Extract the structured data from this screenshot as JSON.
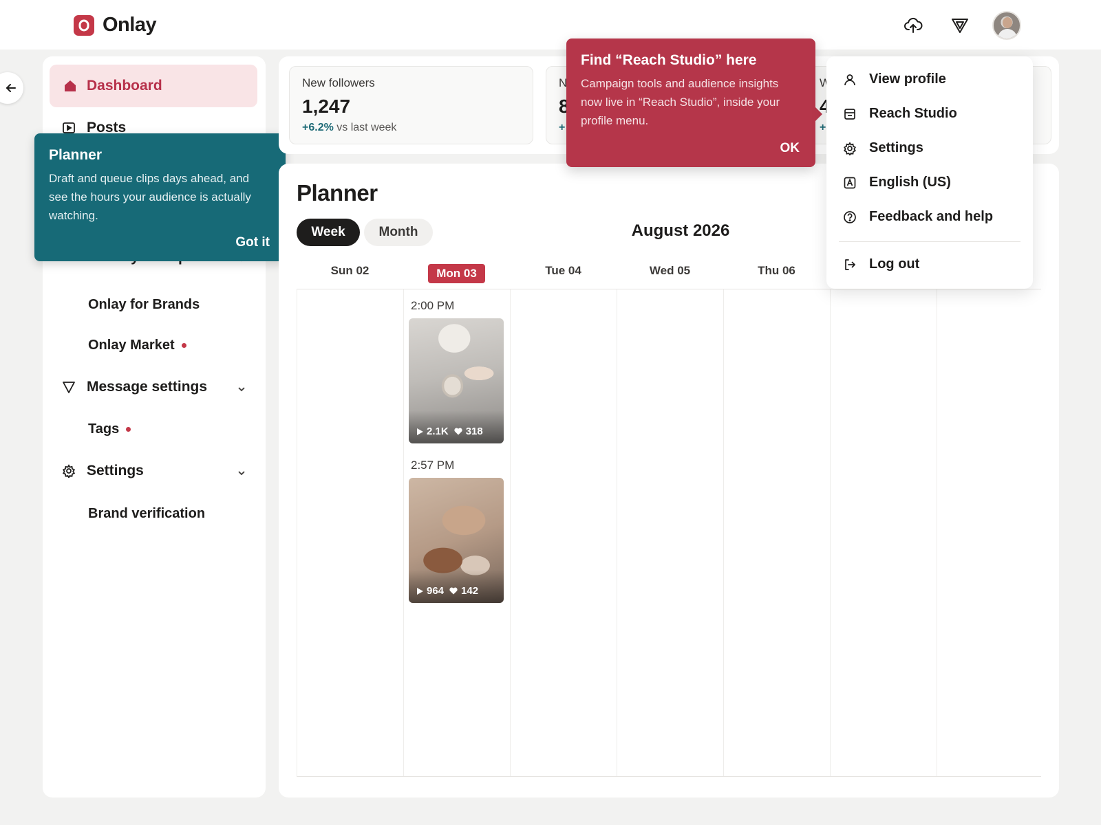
{
  "header": {
    "brand": "Onlay",
    "colors": {
      "brand": "#c43848",
      "teal": "#176a77"
    },
    "icons": [
      "upload-cloud-icon",
      "filter-icon",
      "avatar"
    ]
  },
  "sidebar": {
    "items": [
      {
        "label": "Dashboard",
        "icon": "home-icon",
        "active": true
      },
      {
        "label": "Posts",
        "icon": "play-square-icon"
      },
      {
        "label": "Activity & help",
        "icon": "grid-icon",
        "expandable": true
      },
      {
        "label": "Onlay for Brands",
        "sub": true
      },
      {
        "label": "Onlay Market",
        "sub": true,
        "dot": true
      },
      {
        "label": "Message settings",
        "icon": "filter-icon",
        "expandable": true
      },
      {
        "label": "Tags",
        "sub": true,
        "dot": true
      },
      {
        "label": "Settings",
        "icon": "gear-icon",
        "expandable": true
      },
      {
        "label": "Brand verification",
        "sub": true
      }
    ]
  },
  "planner_tip": {
    "title": "Planner",
    "body": "Draft and queue clips days ahead, and see the hours your audience is actually watching.",
    "action": "Got it"
  },
  "stats": {
    "card1": {
      "label": "New followers",
      "value": "1,247",
      "delta": "+6.2%",
      "delta_suffix": "vs last week"
    },
    "card2": {
      "label": "N",
      "value": "8",
      "delta": "+"
    },
    "card3": {
      "label": "W",
      "value": "4",
      "delta": "+3"
    }
  },
  "reach_tip": {
    "title": "Find “Reach Studio” here",
    "body": "Campaign tools and audience insights now live in “Reach Studio”, inside your profile menu.",
    "action": "OK"
  },
  "profile_menu": {
    "items": [
      {
        "label": "View profile",
        "icon": "user-icon"
      },
      {
        "label": "Reach Studio",
        "icon": "storefront-icon"
      },
      {
        "label": "Settings",
        "icon": "gear-icon"
      },
      {
        "label": "English (US)",
        "icon": "language-icon"
      },
      {
        "label": "Feedback and help",
        "icon": "help-circle-icon"
      },
      {
        "label": "Log out",
        "icon": "logout-icon"
      }
    ]
  },
  "planner": {
    "title": "Planner",
    "views": {
      "week": "Week",
      "month": "Month",
      "selected": "Week"
    },
    "month_label": "August 2026",
    "days": [
      "Sun 02",
      "Mon 03",
      "Tue 04",
      "Wed 05",
      "Thu 06"
    ],
    "today": "Mon 03",
    "slots": [
      {
        "time": "2:00 PM",
        "views": "2.1K",
        "likes": "318"
      },
      {
        "time": "2:57 PM",
        "views": "964",
        "likes": "142"
      }
    ]
  }
}
